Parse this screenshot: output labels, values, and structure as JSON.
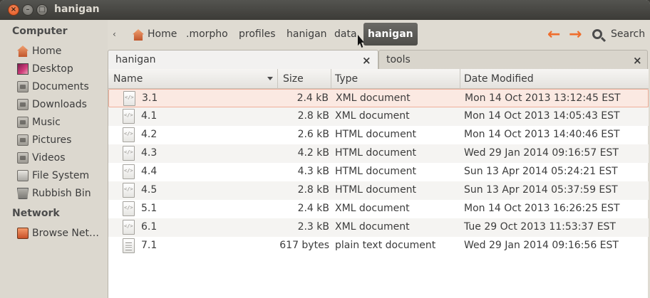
{
  "window": {
    "title": "hanigan"
  },
  "sidebar": {
    "sections": [
      {
        "heading": "Computer",
        "items": [
          {
            "label": "Home",
            "icon": "home-icon"
          },
          {
            "label": "Desktop",
            "icon": "desktop-icon"
          },
          {
            "label": "Documents",
            "icon": "folder-icon"
          },
          {
            "label": "Downloads",
            "icon": "folder-icon"
          },
          {
            "label": "Music",
            "icon": "folder-icon"
          },
          {
            "label": "Pictures",
            "icon": "folder-icon"
          },
          {
            "label": "Videos",
            "icon": "folder-icon"
          },
          {
            "label": "File System",
            "icon": "drive-icon"
          },
          {
            "label": "Rubbish Bin",
            "icon": "trash-icon"
          }
        ]
      },
      {
        "heading": "Network",
        "items": [
          {
            "label": "Browse Net…",
            "icon": "network-icon"
          }
        ]
      }
    ]
  },
  "toolbar": {
    "breadcrumb": [
      "Home",
      ".morpho",
      "profiles",
      "hanigan",
      "data",
      "hanigan"
    ],
    "back_symbol": "‹",
    "back_arrow": "←",
    "forward_arrow": "→",
    "search_label": "Search"
  },
  "tabs": [
    {
      "label": "hanigan",
      "close": "×"
    },
    {
      "label": "tools",
      "close": "×"
    }
  ],
  "columns": [
    "Name",
    "Size",
    "Type",
    "Date Modified"
  ],
  "files": [
    {
      "name": "3.1",
      "size": "2.4 kB",
      "type": "XML document",
      "date": "Mon 14 Oct 2013 13:12:45 EST",
      "icon": "xml-file-icon"
    },
    {
      "name": "4.1",
      "size": "2.8 kB",
      "type": "XML document",
      "date": "Mon 14 Oct 2013 14:05:43 EST",
      "icon": "xml-file-icon"
    },
    {
      "name": "4.2",
      "size": "2.6 kB",
      "type": "HTML document",
      "date": "Mon 14 Oct 2013 14:40:46 EST",
      "icon": "html-file-icon"
    },
    {
      "name": "4.3",
      "size": "4.2 kB",
      "type": "HTML document",
      "date": "Wed 29 Jan 2014 09:16:57 EST",
      "icon": "html-file-icon"
    },
    {
      "name": "4.4",
      "size": "4.3 kB",
      "type": "HTML document",
      "date": "Sun 13 Apr 2014 05:24:21 EST",
      "icon": "html-file-icon"
    },
    {
      "name": "4.5",
      "size": "2.8 kB",
      "type": "HTML document",
      "date": "Sun 13 Apr 2014 05:37:59 EST",
      "icon": "html-file-icon"
    },
    {
      "name": "5.1",
      "size": "2.4 kB",
      "type": "XML document",
      "date": "Mon 14 Oct 2013 16:26:25 EST",
      "icon": "xml-file-icon"
    },
    {
      "name": "6.1",
      "size": "2.3 kB",
      "type": "XML document",
      "date": "Tue 29 Oct 2013 11:53:37 EST",
      "icon": "xml-file-icon"
    },
    {
      "name": "7.1",
      "size": "617 bytes",
      "type": "plain text document",
      "date": "Wed 29 Jan 2014 09:16:56 EST",
      "icon": "text-file-icon"
    }
  ],
  "colors": {
    "accent": "#ef6d2c",
    "selection": "#fbe9e2",
    "titlebar": "#3c3b37"
  }
}
